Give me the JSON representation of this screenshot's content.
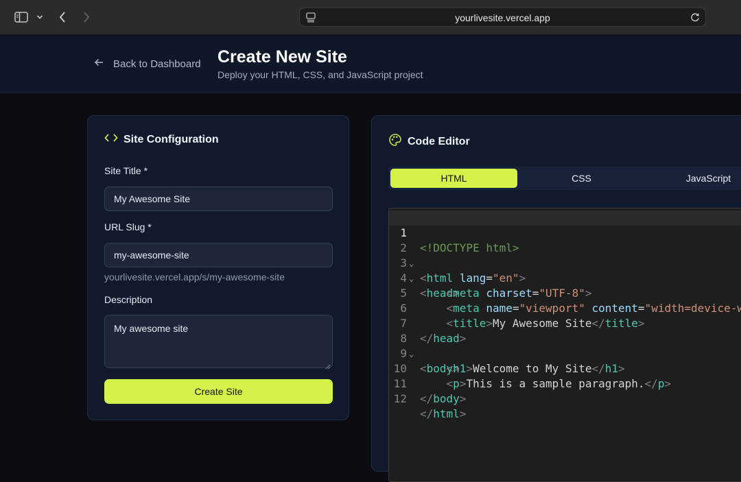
{
  "browser": {
    "url": "yourlivesite.vercel.app"
  },
  "header": {
    "back_label": "Back to Dashboard",
    "title": "Create New Site",
    "subtitle": "Deploy your HTML, CSS, and JavaScript project"
  },
  "config": {
    "heading": "Site Configuration",
    "site_title_label": "Site Title *",
    "site_title_value": "My Awesome Site",
    "slug_label": "URL Slug *",
    "slug_value": "my-awesome-site",
    "slug_hint": "yourlivesite.vercel.app/s/my-awesome-site",
    "description_label": "Description",
    "description_value": "My awesome site",
    "submit_label": "Create Site"
  },
  "editor": {
    "heading": "Code Editor",
    "tabs": [
      "HTML",
      "CSS",
      "JavaScript"
    ],
    "active_tab": "HTML",
    "line_numbers": [
      "1",
      "2",
      "3",
      "4",
      "5",
      "6",
      "7",
      "8",
      "9",
      "10",
      "11",
      "12"
    ],
    "code_lines": [
      "<!DOCTYPE html>",
      "<html lang=\"en\">",
      "<head>",
      "    <meta charset=\"UTF-8\">",
      "    <meta name=\"viewport\" content=\"width=device-w",
      "    <title>My Awesome Site</title>",
      "</head>",
      "<body>",
      "    <h1>Welcome to My Site</h1>",
      "    <p>This is a sample paragraph.</p>",
      "</body>",
      "</html>"
    ]
  },
  "colors": {
    "accent": "#d4f24a",
    "card_bg": "#101a2c",
    "page_bg": "#0b0d12",
    "header_bg": "#0f1829"
  },
  "icons": {
    "sidebar": "sidebar-icon",
    "back": "arrow-left-icon",
    "config": "code-brackets-icon",
    "editor": "palette-icon",
    "reload": "reload-icon"
  }
}
